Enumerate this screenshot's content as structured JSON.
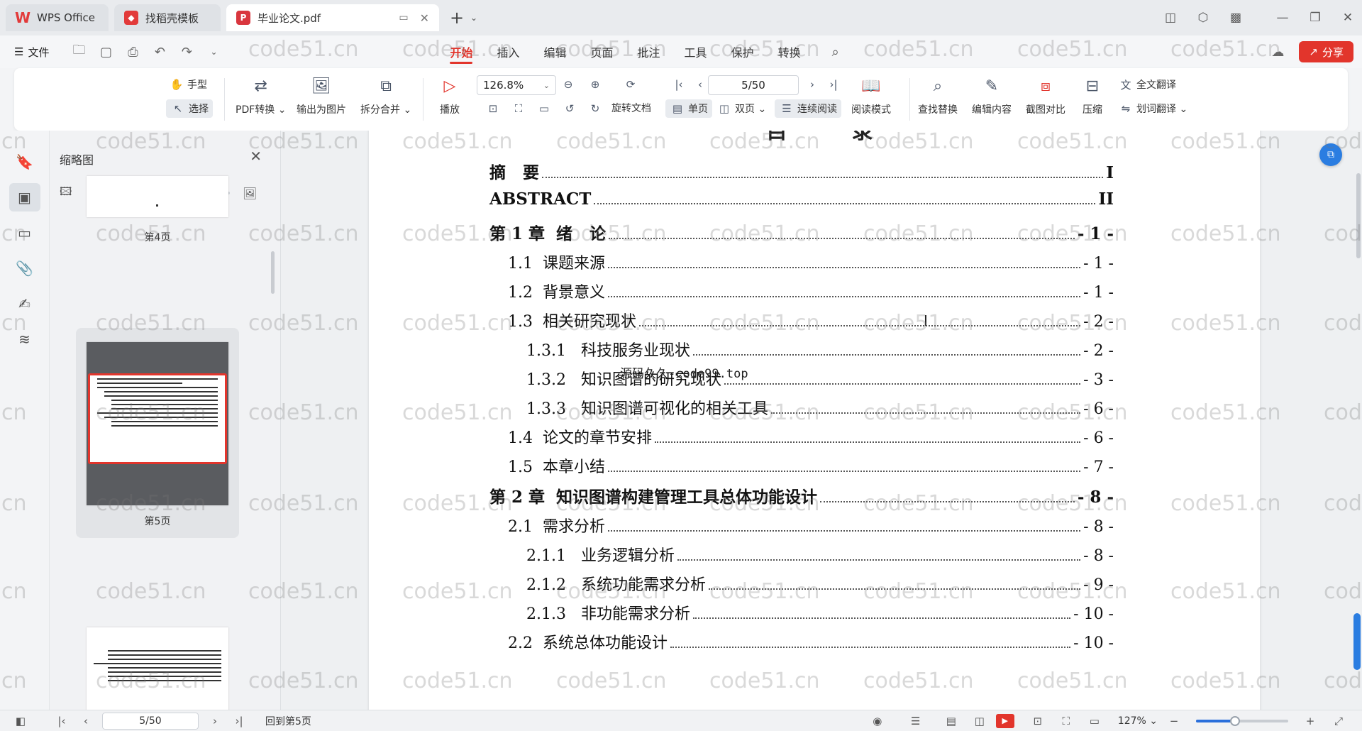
{
  "tabs": [
    {
      "label": "WPS Office",
      "logo": "wps-logo-icon"
    },
    {
      "label": "找稻壳模板",
      "logo": "docer-logo-icon"
    },
    {
      "label": "毕业论文.pdf",
      "logo": "pdf-file-icon"
    }
  ],
  "menu": {
    "file_label": "文件",
    "tabs": [
      "开始",
      "插入",
      "编辑",
      "页面",
      "批注",
      "工具",
      "保护",
      "转换"
    ],
    "active_tab": "开始",
    "share_label": "分享"
  },
  "ribbon": {
    "hand_label": "手型",
    "select_label": "选择",
    "pdf_convert_label": "PDF转换",
    "export_image_label": "输出为图片",
    "split_merge_label": "拆分合并",
    "play_label": "播放",
    "zoom_value": "126.8%",
    "rotate_label": "旋转文档",
    "single_page_label": "单页",
    "double_page_label": "双页",
    "continuous_label": "连续阅读",
    "read_mode_label": "阅读模式",
    "page_value": "5/50",
    "find_replace_label": "查找替换",
    "edit_content_label": "编辑内容",
    "screenshot_compare_label": "截图对比",
    "compress_label": "压缩",
    "full_translate_label": "全文翻译",
    "word_translate_label": "划词翻译"
  },
  "thumbnails": {
    "title": "缩略图",
    "size_fraction": 0.12,
    "pages": [
      {
        "label": "第4页"
      },
      {
        "label": "第5页"
      }
    ]
  },
  "document": {
    "heading": "目  录",
    "toc": [
      {
        "level": 1,
        "label": "摘   要",
        "page": "I"
      },
      {
        "level": 1,
        "label": "ABSTRACT",
        "page": "II"
      },
      {
        "level": 1,
        "label": "第 1 章  绪   论",
        "page": "- 1 -"
      },
      {
        "level": 2,
        "label": "1.1  课题来源",
        "page": "- 1 -"
      },
      {
        "level": 2,
        "label": "1.2  背景意义",
        "page": "- 1 -"
      },
      {
        "level": 2,
        "label": "1.3  相关研究现状",
        "page": "- 2 -"
      },
      {
        "level": 3,
        "label": "1.3.1   科技服务业现状",
        "page": "- 2 -"
      },
      {
        "level": 3,
        "label": "1.3.2   知识图谱的研究现状",
        "page": "- 3 -"
      },
      {
        "level": 3,
        "label": "1.3.3   知识图谱可视化的相关工具",
        "page": "- 6 -"
      },
      {
        "level": 2,
        "label": "1.4  论文的章节安排",
        "page": "- 6 -"
      },
      {
        "level": 2,
        "label": "1.5  本章小结",
        "page": "- 7 -"
      },
      {
        "level": 1,
        "label": "第 2 章  知识图谱构建管理工具总体功能设计",
        "page": "- 8 -"
      },
      {
        "level": 2,
        "label": "2.1  需求分析",
        "page": "- 8 -"
      },
      {
        "level": 3,
        "label": "2.1.1   业务逻辑分析",
        "page": "- 8 -"
      },
      {
        "level": 3,
        "label": "2.1.2   系统功能需求分析",
        "page": "- 9 -"
      },
      {
        "level": 3,
        "label": "2.1.3   非功能需求分析",
        "page": "- 10 -"
      },
      {
        "level": 2,
        "label": "2.2  系统总体功能设计",
        "page": "- 10 -"
      }
    ],
    "overlay_text": "源码久久-code99.top"
  },
  "watermark_text": "code51.cn",
  "watermark_short": "cn",
  "watermark_partial": "cod",
  "statusbar": {
    "page_value": "5/50",
    "goto_label": "回到第5页",
    "zoom_label": "127%",
    "zoom_fraction": 0.42
  },
  "colors": {
    "accent": "#e2352c",
    "blue": "#2a6fdb"
  }
}
